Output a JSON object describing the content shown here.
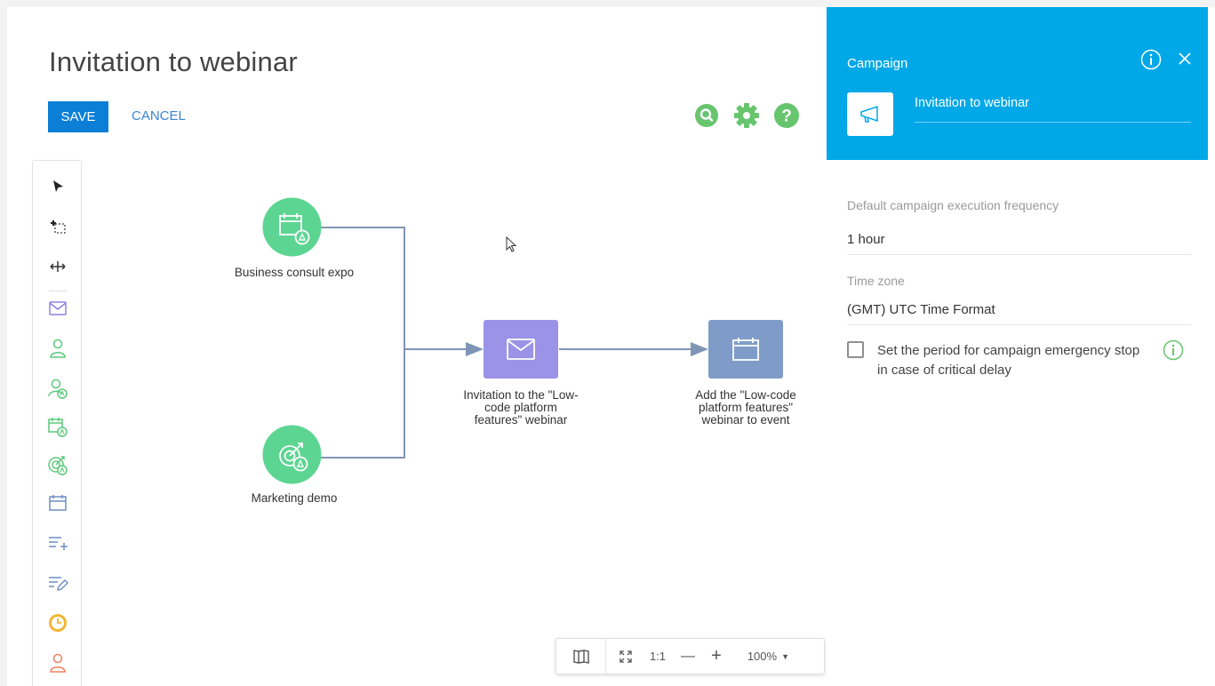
{
  "page": {
    "title": "Invitation to webinar",
    "save_label": "SAVE",
    "cancel_label": "CANCEL"
  },
  "header_icons": [
    "search-icon",
    "gear-icon",
    "help-icon"
  ],
  "toolbar": {
    "tools": [
      "pointer-icon",
      "add-selection-icon",
      "move-canvas-icon",
      "email-icon",
      "add-audience-icon",
      "audience-condition-icon",
      "event-audience-icon",
      "landing-audience-icon",
      "add-event-icon",
      "add-data-icon",
      "modify-data-icon",
      "timer-icon",
      "exit-audience-icon"
    ]
  },
  "diagram": {
    "nodes": [
      {
        "id": "business-consult-expo",
        "label": "Business consult expo",
        "type": "event-audience",
        "color": "#5dd592"
      },
      {
        "id": "marketing-demo",
        "label": "Marketing demo",
        "type": "landing-audience",
        "color": "#5dd592"
      },
      {
        "id": "invitation-email",
        "label": "Invitation to the \"Low-code platform features\" webinar",
        "label_lines": [
          "Invitation to the \"Low-",
          "code platform",
          "features\" webinar"
        ],
        "type": "email",
        "color": "#9b93e8"
      },
      {
        "id": "add-to-event",
        "label": "Add the \"Low-code platform features\" webinar to event",
        "label_lines": [
          "Add the \"Low-code",
          "platform features\"",
          "webinar to event"
        ],
        "type": "add-event",
        "color": "#7f9cc9"
      }
    ],
    "flows": [
      {
        "from": "business-consult-expo",
        "to": "invitation-email"
      },
      {
        "from": "marketing-demo",
        "to": "invitation-email"
      },
      {
        "from": "invitation-email",
        "to": "add-to-event"
      }
    ]
  },
  "zoom_bar": {
    "fit_label": "1:1",
    "minus_label": "—",
    "plus_label": "+",
    "zoom_level": "100%"
  },
  "panel": {
    "caption": "Campaign",
    "campaign_name": "Invitation to webinar",
    "frequency_label": "Default campaign execution frequency",
    "frequency_value": "1 hour",
    "timezone_label": "Time zone",
    "timezone_value": "(GMT) UTC Time Format",
    "emergency_stop_label": "Set the period for campaign emergency stop in case of critical delay",
    "emergency_stop_checked": false
  },
  "colors": {
    "accent": "#0b7fd6",
    "panel_header": "#00a8e8",
    "green": "#67c56e",
    "flow_line": "#7f95b5"
  }
}
